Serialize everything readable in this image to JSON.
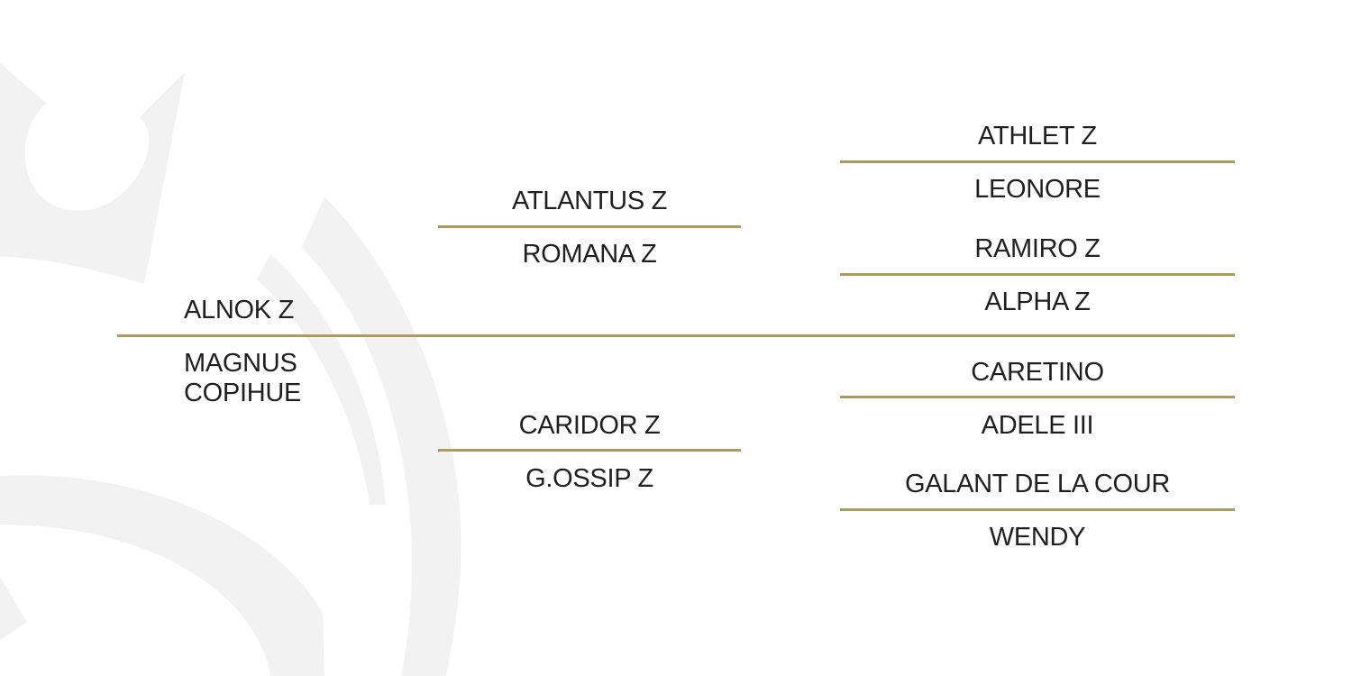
{
  "colors": {
    "background": "#ffffff",
    "text": "#1f1f1f",
    "divider": "#ab9b5c",
    "watermark": "#f2f2f2"
  },
  "pedigree": {
    "sire": "ALNOK Z",
    "dam": "MAGNUS\nCOPIHUE",
    "grandparents": {
      "paternal_grandsire": "ATLANTUS Z",
      "paternal_granddam": "ROMANA Z",
      "maternal_grandsire": "CARIDOR Z",
      "maternal_granddam": "G.OSSIP Z"
    },
    "great_grandparents": {
      "sire_of_atlantus": "ATHLET Z",
      "dam_of_atlantus": "LEONORE",
      "sire_of_romana": "RAMIRO Z",
      "dam_of_romana": "ALPHA Z",
      "sire_of_caridor": "CARETINO",
      "dam_of_caridor": "ADELE III",
      "sire_of_gossip": "GALANT DE LA COUR",
      "dam_of_gossip": "WENDY"
    }
  },
  "watermark_icon": "crest-watermark-icon"
}
